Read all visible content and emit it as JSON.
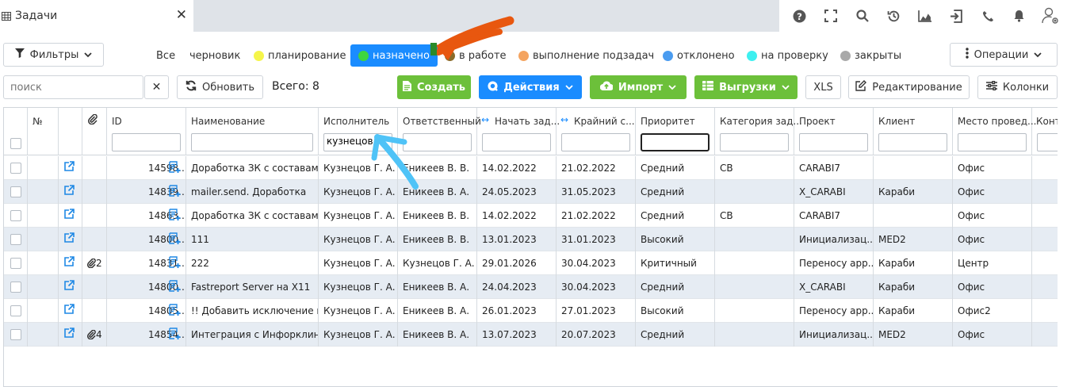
{
  "tab": {
    "title": "Задачи"
  },
  "toolbar1": {
    "filters_label": "Фильтры",
    "operations_label": "Операции",
    "statuses": [
      {
        "label": "Все",
        "color": ""
      },
      {
        "label": "черновик",
        "color": ""
      },
      {
        "label": "планирование",
        "color": "#f5f54a"
      },
      {
        "label": "назначено",
        "color": "#3ed63e",
        "active": true
      },
      {
        "label": "в работе",
        "color": "#8a6b2a"
      },
      {
        "label": "выполнение подзадач",
        "color": "#f4a460"
      },
      {
        "label": "отклонено",
        "color": "#4a9cf0"
      },
      {
        "label": "на проверку",
        "color": "#3ef0f0"
      },
      {
        "label": "закрыты",
        "color": "#a9a9a9"
      }
    ]
  },
  "toolbar2": {
    "search_placeholder": "поиск",
    "refresh_label": "Обновить",
    "total_label": "Всего: 8",
    "create_label": "Создать",
    "actions_label": "Действия",
    "import_label": "Импорт",
    "export_label": "Выгрузки",
    "xls_label": "XLS",
    "edit_label": "Редактирование",
    "columns_label": "Колонки"
  },
  "colors": {
    "accent_blue": "#1a8cff",
    "accent_green": "#6cc03a",
    "link_blue": "#1e88e5",
    "annot_orange": "#e8570f",
    "annot_cyan": "#4fc3f7"
  },
  "table": {
    "headers": [
      "",
      "№",
      "",
      "",
      "ID",
      "Наименование",
      "Исполнитель",
      "Ответственный",
      "Начать зад...",
      "Крайний с...",
      "Приоритет",
      "Категория зад...",
      "Проект",
      "Клиент",
      "Место провед...",
      "Конт"
    ],
    "filter_executor": "кузнецов",
    "rows": [
      {
        "attach": "",
        "id": "14598...",
        "name": "Доработка ЗК с составами",
        "executor": "Кузнецов Г. А.",
        "responsible": "Еникеев В. В.",
        "start": "14.02.2022",
        "deadline": "21.02.2022",
        "priority": "Средний",
        "category": "СВ",
        "project": "CARABI7",
        "client": "",
        "place": "Офис"
      },
      {
        "attach": "",
        "id": "14839...",
        "name": "mailer.send. Доработка",
        "executor": "Кузнецов Г. А.",
        "responsible": "Еникеев В. А.",
        "start": "24.05.2023",
        "deadline": "31.05.2023",
        "priority": "Средний",
        "category": "",
        "project": "X_CARABI",
        "client": "Караби",
        "place": "Офис"
      },
      {
        "attach": "",
        "id": "14863...",
        "name": "Доработка ЗК с составами",
        "executor": "Кузнецов Г. А.",
        "responsible": "Еникеев В. В.",
        "start": "14.02.2022",
        "deadline": "21.02.2022",
        "priority": "Средний",
        "category": "СВ",
        "project": "CARABI7",
        "client": "",
        "place": "Офис"
      },
      {
        "attach": "",
        "id": "14800...",
        "name": "111",
        "executor": "Кузнецов Г. А.",
        "responsible": "Еникеев В. В.",
        "start": "13.01.2023",
        "deadline": "31.01.2023",
        "priority": "Высокий",
        "category": "",
        "project": "Инициализац...",
        "client": "MED2",
        "place": "Офис"
      },
      {
        "attach": "2",
        "id": "14831...",
        "name": "222",
        "executor": "Кузнецов Г. А.",
        "responsible": "Кузнецов Г. А.",
        "start": "29.01.2026",
        "deadline": "30.04.2023",
        "priority": "Критичный",
        "category": "",
        "project": "Переносу арр...",
        "client": "Караби",
        "place": "Центр"
      },
      {
        "attach": "",
        "id": "14800...",
        "name": "Fastreport Server на X11",
        "executor": "Кузнецов Г. А.",
        "responsible": "Еникеев В. А.",
        "start": "24.04.2023",
        "deadline": "30.04.2023",
        "priority": "Средний",
        "category": "",
        "project": "X_CARABI",
        "client": "Караби",
        "place": "Офис"
      },
      {
        "attach": "",
        "id": "14805...",
        "name": "!! Добавить исключение в...",
        "executor": "Кузнецов Г. А.",
        "responsible": "Еникеев В. А.",
        "start": "26.01.2023",
        "deadline": "27.01.2023",
        "priority": "Высокий",
        "category": "",
        "project": "Переносу арр...",
        "client": "Караби",
        "place": "Офис2"
      },
      {
        "attach": "4",
        "id": "14854...",
        "name": "Интеграция с Инфорклин...",
        "executor": "Кузнецов Г. А.",
        "responsible": "Еникеев В. А.",
        "start": "13.07.2023",
        "deadline": "20.07.2023",
        "priority": "Средний",
        "category": "",
        "project": "Инициализац...",
        "client": "MED2",
        "place": "Офис"
      }
    ]
  }
}
